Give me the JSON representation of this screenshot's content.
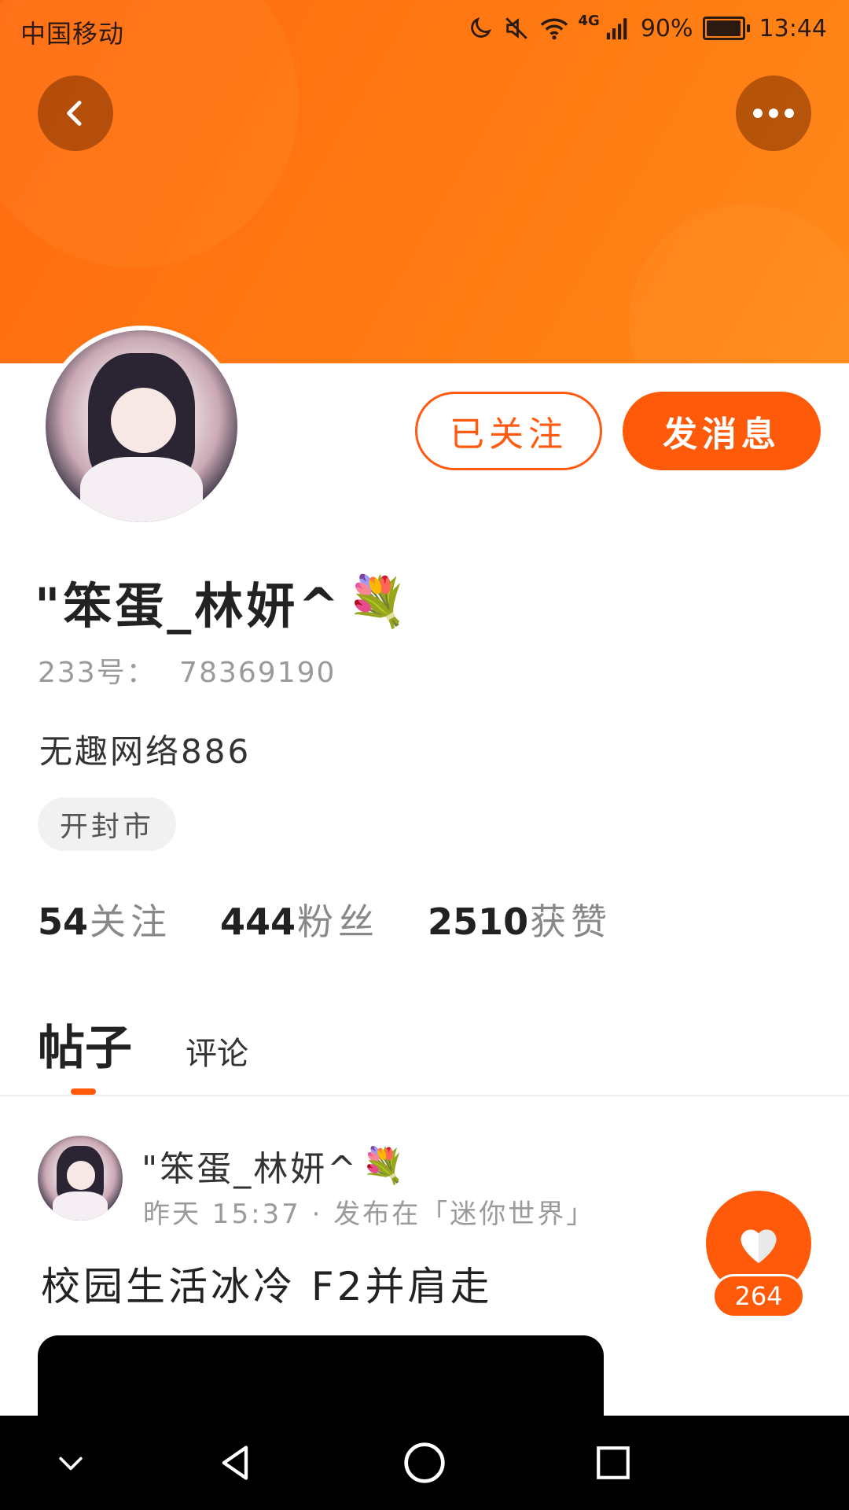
{
  "status_bar": {
    "carrier": "中国移动",
    "network": "4G",
    "battery_percent": "90%",
    "battery_level": 0.9,
    "time": "13:44",
    "icons": [
      "moon-icon",
      "mute-icon",
      "wifi-icon",
      "signal-icon",
      "battery-icon"
    ]
  },
  "header": {
    "back_icon": "chevron-left-icon",
    "more_icon": "more-dots-icon"
  },
  "profile": {
    "follow_label": "已关注",
    "message_label": "发消息",
    "username": "\"笨蛋_林妍^",
    "username_emoji": "💐",
    "id_label": "233号：",
    "id_value": "78369190",
    "bio": "无趣网络886",
    "location": "开封市",
    "stats": [
      {
        "num": "54",
        "label": "关注"
      },
      {
        "num": "444",
        "label": "粉丝"
      },
      {
        "num": "2510",
        "label": "获赞"
      }
    ]
  },
  "tabs": [
    {
      "label": "帖子",
      "active": true
    },
    {
      "label": "评论",
      "active": false
    }
  ],
  "post": {
    "author": "\"笨蛋_林妍^",
    "author_emoji": "💐",
    "meta": "昨天 15:37 · 发布在「迷你世界」",
    "title": "校园生活冰冷 F2并肩走",
    "likes": "264"
  },
  "colors": {
    "accent": "#ff5a0a",
    "header_gradient_start": "#ff6a10",
    "header_gradient_end": "#ff8a1a"
  },
  "nav_bar": {
    "icons": [
      "collapse-icon",
      "back-icon",
      "home-icon",
      "recents-icon"
    ]
  }
}
